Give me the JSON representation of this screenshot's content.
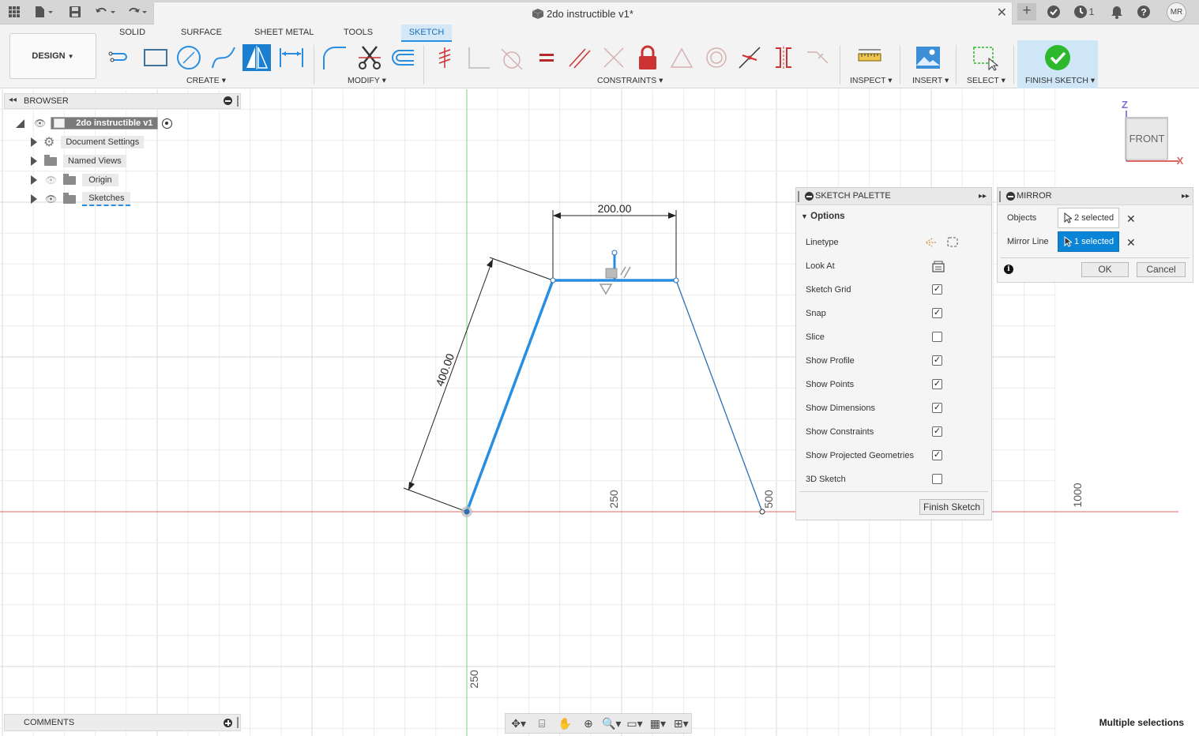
{
  "window": {
    "title": "2do instructible v1*",
    "user_initials": "MR",
    "job_count": "1"
  },
  "workspace": {
    "design_label": "DESIGN"
  },
  "tabs": [
    "SOLID",
    "SURFACE",
    "SHEET METAL",
    "TOOLS",
    "SKETCH"
  ],
  "active_tab": "SKETCH",
  "groups": {
    "create": "CREATE",
    "modify": "MODIFY",
    "constraints": "CONSTRAINTS",
    "inspect": "INSPECT",
    "insert": "INSERT",
    "select": "SELECT",
    "finish": "FINISH SKETCH"
  },
  "browser": {
    "title": "BROWSER",
    "root": "2do instructible v1",
    "items": [
      "Document Settings",
      "Named Views",
      "Origin",
      "Sketches"
    ]
  },
  "viewcube": {
    "face": "FRONT",
    "axis_z": "Z",
    "axis_x": "X"
  },
  "sketch": {
    "dim_width": "200.00",
    "dim_length": "400.00",
    "grid_labels": {
      "x250": "250",
      "x500": "500",
      "x1000": "1000",
      "y250": "250"
    }
  },
  "palette": {
    "title": "SKETCH PALETTE",
    "section": "Options",
    "rows": [
      {
        "label": "Linetype",
        "kind": "icon"
      },
      {
        "label": "Look At",
        "kind": "icon"
      },
      {
        "label": "Sketch Grid",
        "kind": "checkbox",
        "checked": true
      },
      {
        "label": "Snap",
        "kind": "checkbox",
        "checked": true
      },
      {
        "label": "Slice",
        "kind": "checkbox",
        "checked": false
      },
      {
        "label": "Show Profile",
        "kind": "checkbox",
        "checked": true
      },
      {
        "label": "Show Points",
        "kind": "checkbox",
        "checked": true
      },
      {
        "label": "Show Dimensions",
        "kind": "checkbox",
        "checked": true
      },
      {
        "label": "Show Constraints",
        "kind": "checkbox",
        "checked": true
      },
      {
        "label": "Show Projected Geometries",
        "kind": "checkbox",
        "checked": true
      },
      {
        "label": "3D Sketch",
        "kind": "checkbox",
        "checked": false
      }
    ],
    "finish_button": "Finish Sketch"
  },
  "mirror": {
    "title": "MIRROR",
    "objects_label": "Objects",
    "objects_value": "2 selected",
    "mirror_line_label": "Mirror Line",
    "mirror_line_value": "1 selected",
    "ok": "OK",
    "cancel": "Cancel"
  },
  "comments": {
    "title": "COMMENTS"
  },
  "status": {
    "text": "Multiple selections"
  },
  "colors": {
    "accent": "#0a84d6",
    "sketch_blue": "#2a8ee0",
    "finish_green": "#2eb82e"
  }
}
